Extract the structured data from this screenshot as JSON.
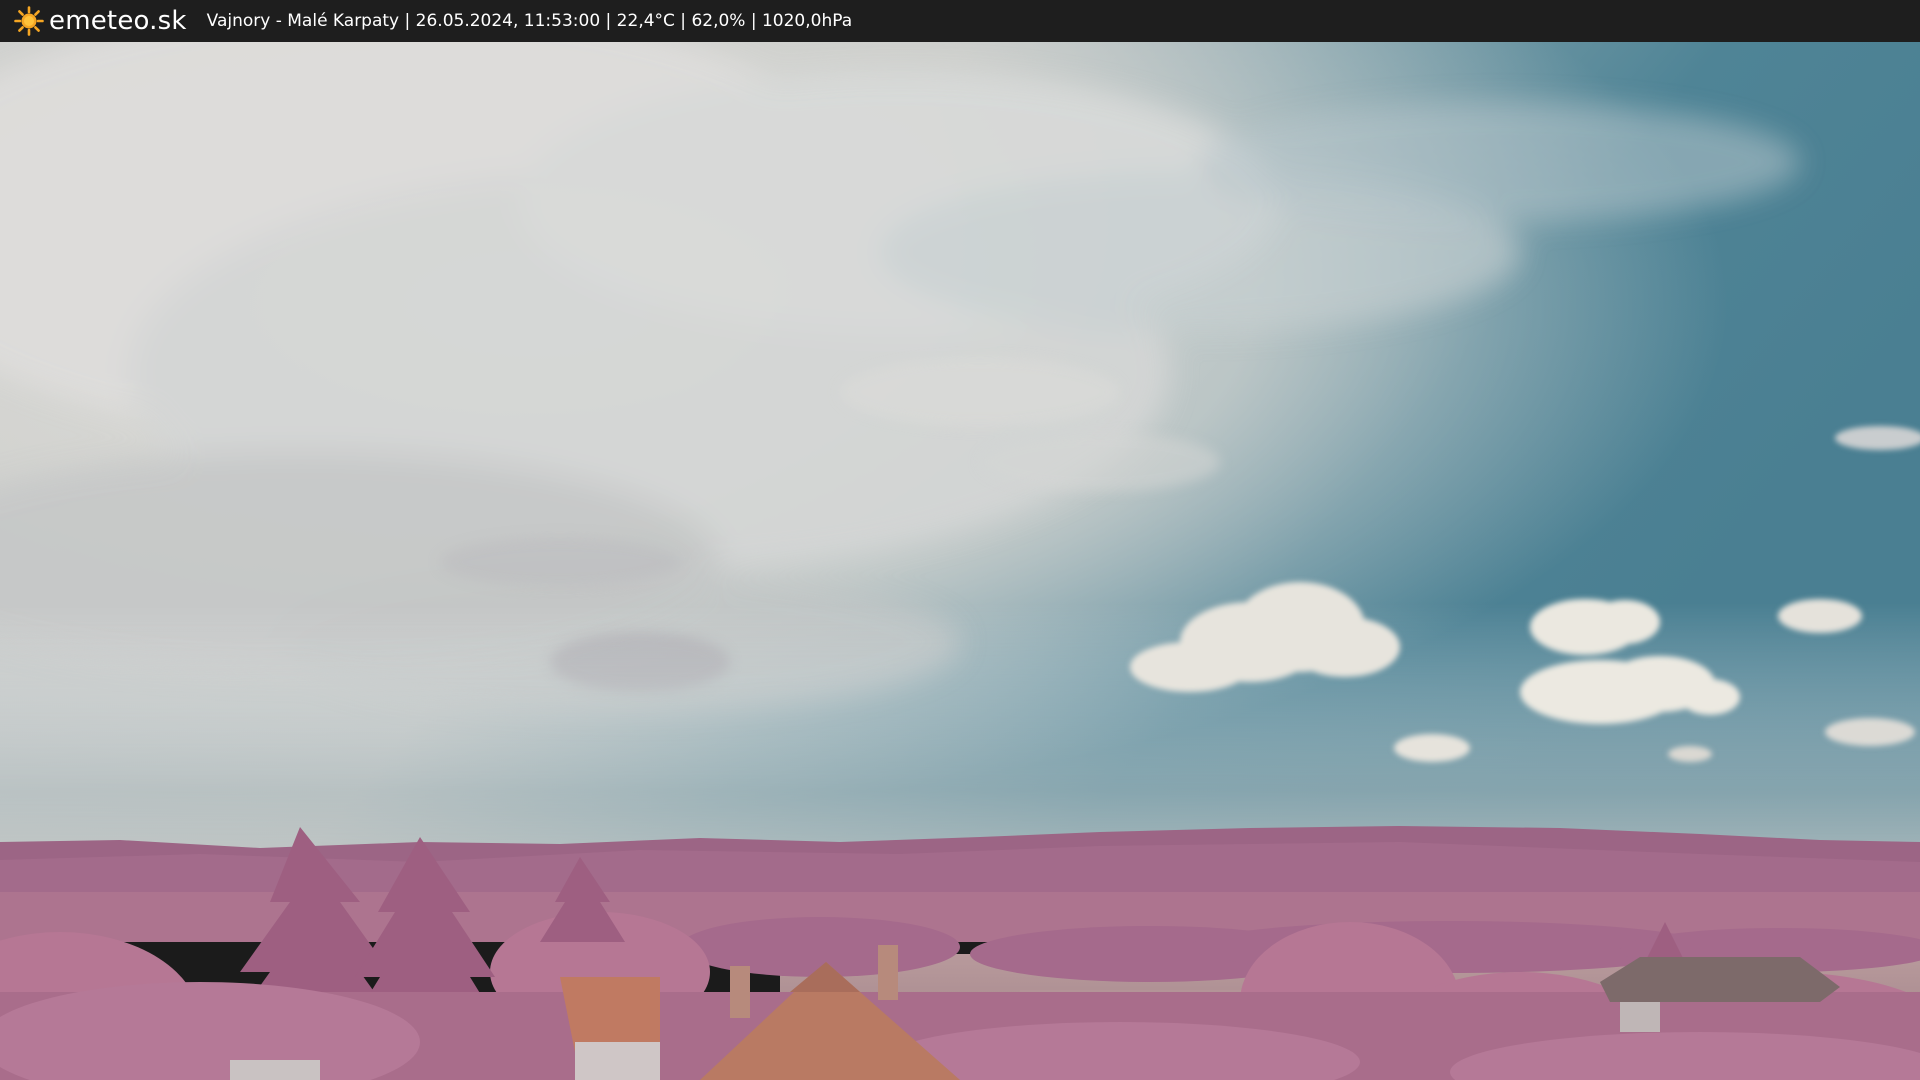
{
  "header": {
    "logo_icon": "sun-icon",
    "brand": "emeteo.sk",
    "caption": "Vajnory - Malé Karpaty | 26.05.2024, 11:53:00 | 22,4°C | 62,0% | 1020,0hPa"
  },
  "colors": {
    "bar_background": "#1e1e1e",
    "bar_text": "#ffffff",
    "sun": "#f5a623",
    "sky_blue": "#4b8092",
    "clouds": "#dcdcd6",
    "foliage": "#b06d8f",
    "hills": "#9a6282"
  }
}
